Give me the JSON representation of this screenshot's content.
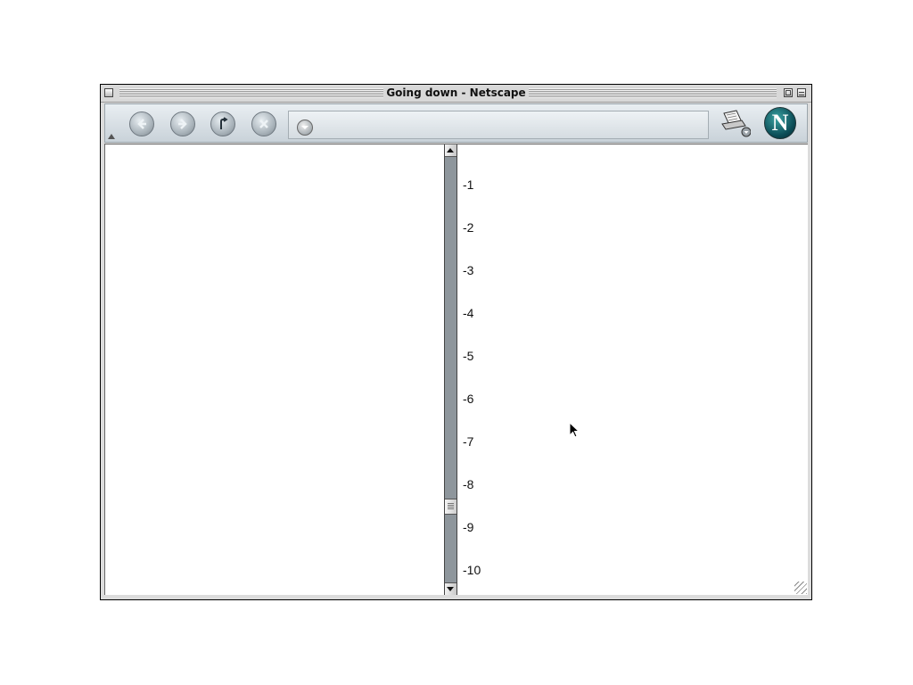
{
  "window": {
    "title": "Going down - Netscape"
  },
  "toolbar": {
    "back_icon": "back-arrow-icon",
    "forward_icon": "forward-arrow-icon",
    "reload_icon": "reload-icon",
    "stop_icon": "stop-icon",
    "url_dropdown_icon": "chevron-down-icon",
    "print_icon": "print-icon",
    "logo_letter": "N"
  },
  "right_frame": {
    "lines": [
      "-1",
      "-2",
      "-3",
      "-4",
      "-5",
      "-6",
      "-7",
      "-8",
      "-9",
      "-10"
    ]
  },
  "scrollbar": {
    "position_fraction": 0.82
  }
}
